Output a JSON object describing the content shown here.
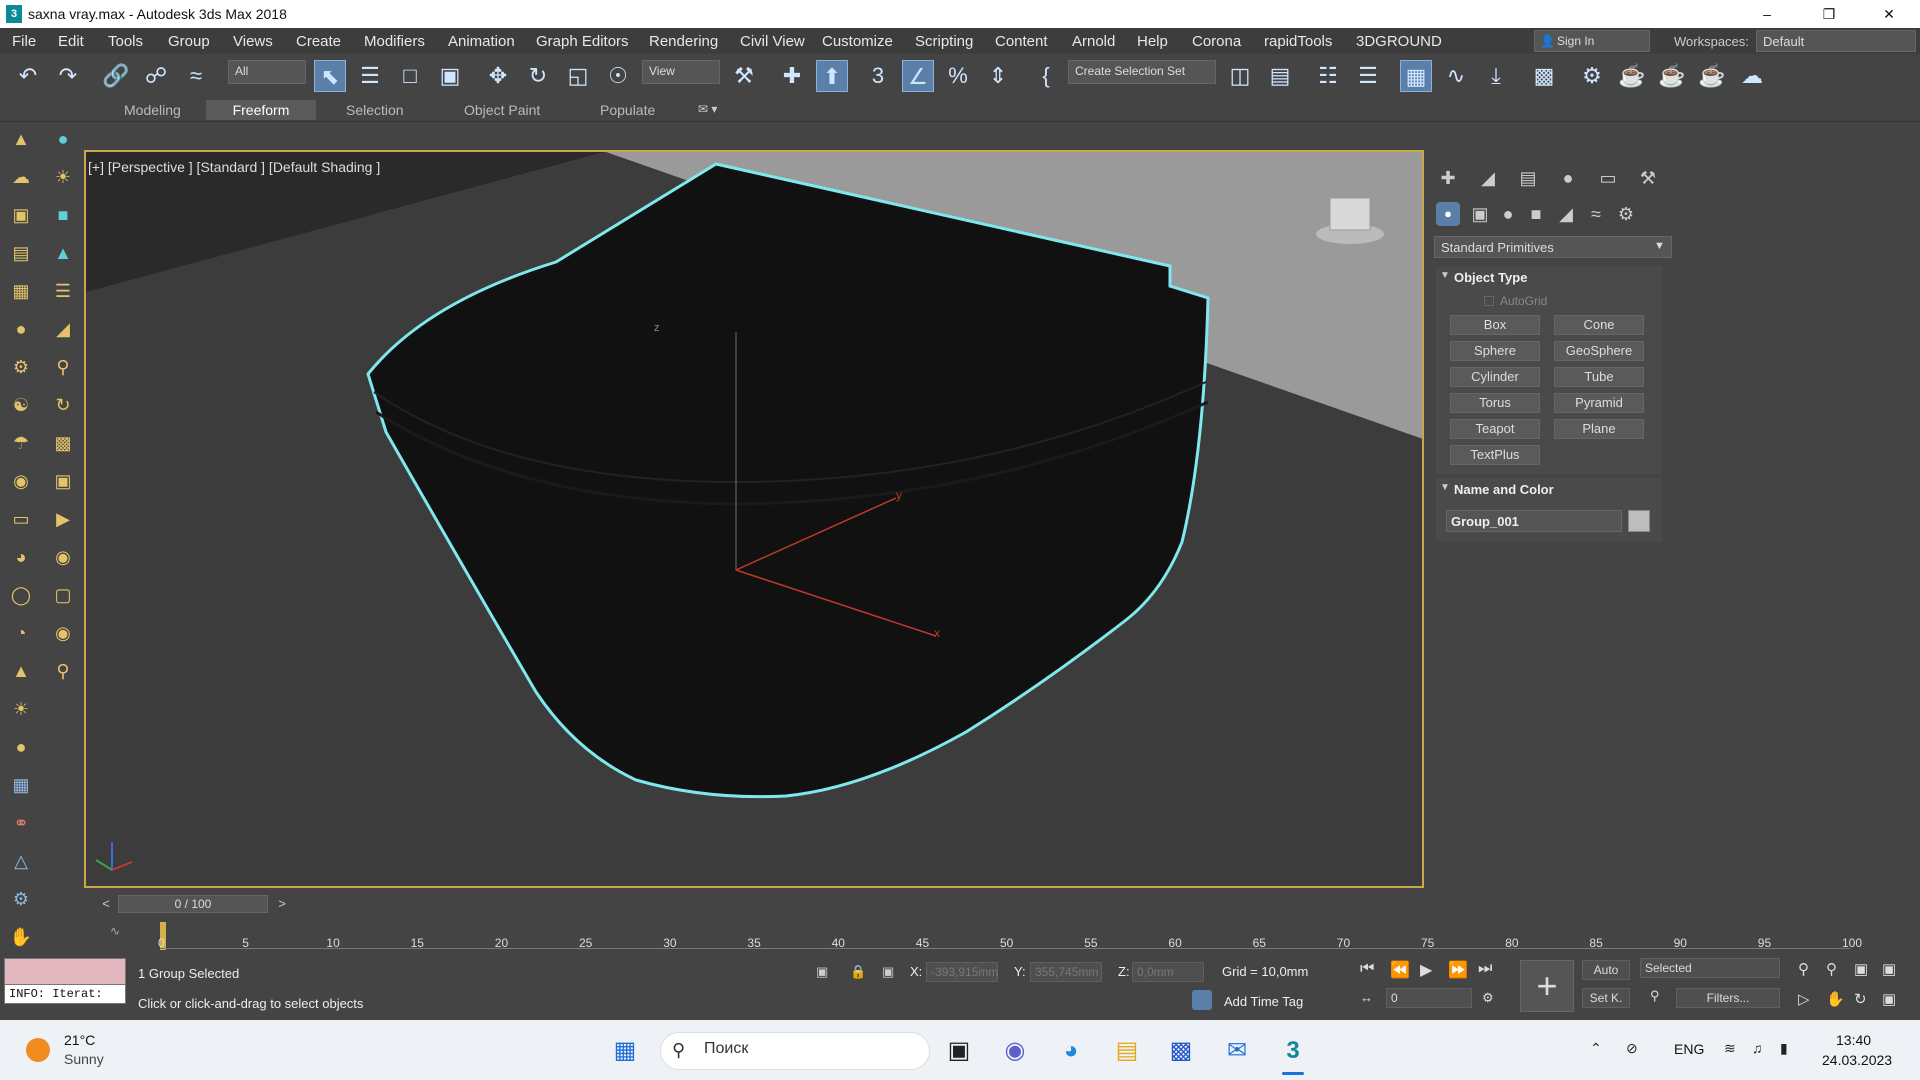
{
  "window": {
    "title": "saxna vray.max - Autodesk 3ds Max 2018",
    "logo": "3"
  },
  "menu": [
    "File",
    "Edit",
    "Tools",
    "Group",
    "Views",
    "Create",
    "Modifiers",
    "Animation",
    "Graph Editors",
    "Rendering",
    "Civil View",
    "Customize",
    "Scripting",
    "Content",
    "Arnold",
    "Help",
    "Corona",
    "rapidTools",
    "3DGROUND"
  ],
  "account": {
    "sign_in": "Sign In",
    "workspaces_label": "Workspaces:",
    "workspace": "Default"
  },
  "toolbar": {
    "filter": "All",
    "refcoord": "View",
    "selection_set": "Create Selection Set"
  },
  "ribbon_tabs": [
    "Modeling",
    "Freeform",
    "Selection",
    "Object Paint",
    "Populate"
  ],
  "ribbon_active": "Freeform",
  "viewport": {
    "label": "[+] [Perspective ] [Standard ] [Default Shading ]",
    "axis_z": "z",
    "axis_y": "y",
    "axis_x": "x"
  },
  "command_panel": {
    "category": "Standard Primitives",
    "object_type_title": "Object Type",
    "autogrid": "AutoGrid",
    "buttons": [
      "Box",
      "Cone",
      "Sphere",
      "GeoSphere",
      "Cylinder",
      "Tube",
      "Torus",
      "Pyramid",
      "Teapot",
      "Plane",
      "TextPlus"
    ],
    "name_color_title": "Name and Color",
    "object_name": "Group_001",
    "object_color": "#bdbdbd"
  },
  "timeline": {
    "frame": "0 / 100",
    "ticks": [
      "0",
      "5",
      "10",
      "15",
      "20",
      "25",
      "30",
      "35",
      "40",
      "45",
      "50",
      "55",
      "60",
      "65",
      "70",
      "75",
      "80",
      "85",
      "90",
      "95",
      "100"
    ]
  },
  "status": {
    "maxscript": "INFO: Iterat:",
    "selection": "1 Group Selected",
    "prompt": "Click or click-and-drag to select objects",
    "x_label": "X:",
    "x_value": "-393,915mm",
    "y_label": "Y:",
    "y_value": "355,745mm",
    "z_label": "Z:",
    "z_value": "0,0mm",
    "grid": "Grid = 10,0mm",
    "add_time_tag": "Add Time Tag",
    "auto": "Auto",
    "set_key": "Set K.",
    "key_mode": "Selected",
    "filters": "Filters...",
    "frame_field": "0"
  },
  "taskbar": {
    "temp": "21°C",
    "weather": "Sunny",
    "search": "Поиск",
    "lang": "ENG",
    "time": "13:40",
    "date": "24.03.2023"
  },
  "colors": {
    "accent": "#5a7fa8",
    "selection_outline": "#7fe8ee",
    "viewport_border": "#c8a84a"
  }
}
